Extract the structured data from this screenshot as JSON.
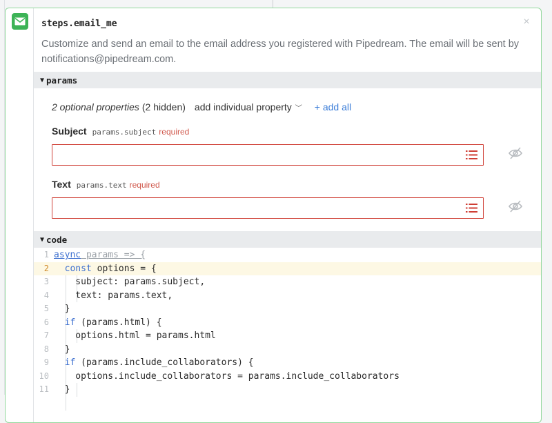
{
  "step": {
    "title": "steps.email_me",
    "close_symbol": "×",
    "description": "Customize and send an email to the email address you registered with Pipedream. The email will be sent by notifications@pipedream.com."
  },
  "sections": {
    "params_label": "params",
    "code_label": "code",
    "caret": "▼"
  },
  "params": {
    "optional_props": "2 optional properties",
    "hidden_count": "(2 hidden)",
    "add_individual": "add individual property",
    "add_individual_chevron": "﹀",
    "add_all": "+ add all",
    "fields": [
      {
        "label": "Subject",
        "path": "params.subject",
        "required": "required",
        "value": ""
      },
      {
        "label": "Text",
        "path": "params.text",
        "required": "required",
        "value": ""
      }
    ]
  },
  "code": {
    "lines": [
      {
        "n": "1",
        "pre": "",
        "kw": "async",
        "post": " params => {"
      },
      {
        "n": "2",
        "pre": "  ",
        "kw": "const",
        "post": " options = {"
      },
      {
        "n": "3",
        "pre": "    subject: params.subject,",
        "kw": "",
        "post": ""
      },
      {
        "n": "4",
        "pre": "    text: params.text,",
        "kw": "",
        "post": ""
      },
      {
        "n": "5",
        "pre": "  }",
        "kw": "",
        "post": ""
      },
      {
        "n": "6",
        "pre": "  ",
        "kw": "if",
        "post": " (params.html) {"
      },
      {
        "n": "7",
        "pre": "    options.html = params.html",
        "kw": "",
        "post": ""
      },
      {
        "n": "8",
        "pre": "  }",
        "kw": "",
        "post": ""
      },
      {
        "n": "9",
        "pre": "  ",
        "kw": "if",
        "post": " (params.include_collaborators) {"
      },
      {
        "n": "10",
        "pre": "    options.include_collaborators = params.include_collaborators",
        "kw": "",
        "post": ""
      },
      {
        "n": "11",
        "pre": "  }",
        "kw": "",
        "post": ""
      }
    ],
    "active_line": "2"
  },
  "colors": {
    "accent_green": "#3cb356",
    "border_green": "#8fd79a",
    "error_red": "#cf3e34",
    "link_blue": "#3b7dd8",
    "keyword_blue": "#3c6fcf"
  },
  "icons": {
    "step": "mail-icon",
    "close": "close-icon",
    "field_list": "list-icon",
    "field_visibility": "eye-slash-icon"
  }
}
